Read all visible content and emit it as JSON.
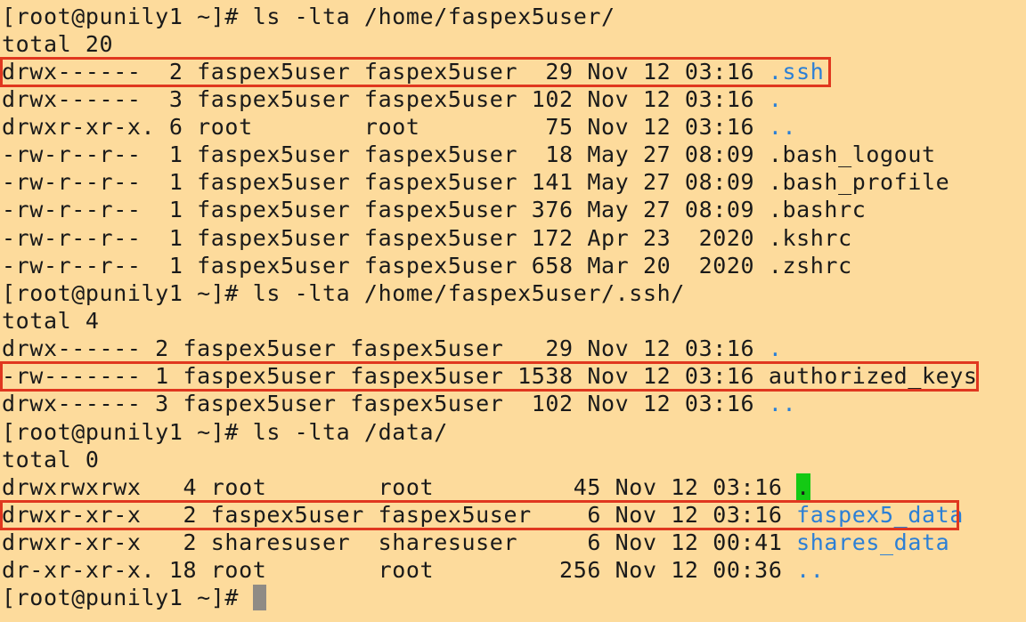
{
  "terminal": {
    "background": "#fddb9c",
    "link_color": "#2b7fd6",
    "highlight_color": "#e0371f",
    "cursor_color": "#8f8b85",
    "lines": [
      {
        "text": "[root@punily1 ~]# ls -lta /home/faspex5user/",
        "name": ""
      },
      {
        "text": "total 20",
        "name": ""
      },
      {
        "text": "drwx------  2 faspex5user faspex5user  29 Nov 12 03:16 ",
        "name": ".ssh"
      },
      {
        "text": "drwx------  3 faspex5user faspex5user 102 Nov 12 03:16 ",
        "name": "."
      },
      {
        "text": "drwxr-xr-x. 6 root        root         75 Nov 12 03:16 ",
        "name": ".."
      },
      {
        "text": "-rw-r--r--  1 faspex5user faspex5user  18 May 27 08:09 .bash_logout",
        "name": ""
      },
      {
        "text": "-rw-r--r--  1 faspex5user faspex5user 141 May 27 08:09 .bash_profile",
        "name": ""
      },
      {
        "text": "-rw-r--r--  1 faspex5user faspex5user 376 May 27 08:09 .bashrc",
        "name": ""
      },
      {
        "text": "-rw-r--r--  1 faspex5user faspex5user 172 Apr 23  2020 .kshrc",
        "name": ""
      },
      {
        "text": "-rw-r--r--  1 faspex5user faspex5user 658 Mar 20  2020 .zshrc",
        "name": ""
      },
      {
        "text": "[root@punily1 ~]# ls -lta /home/faspex5user/.ssh/",
        "name": ""
      },
      {
        "text": "total 4",
        "name": ""
      },
      {
        "text": "drwx------ 2 faspex5user faspex5user   29 Nov 12 03:16 ",
        "name": "."
      },
      {
        "text": "-rw------- 1 faspex5user faspex5user 1538 Nov 12 03:16 authorized_keys",
        "name": ""
      },
      {
        "text": "drwx------ 3 faspex5user faspex5user  102 Nov 12 03:16 ",
        "name": ".."
      },
      {
        "text": "[root@punily1 ~]# ls -lta /data/",
        "name": ""
      },
      {
        "text": "total 0",
        "name": ""
      },
      {
        "text": "drwxrwxrwx   4 root        root          45 Nov 12 03:16 ",
        "name": "."
      },
      {
        "text": "drwxr-xr-x   2 faspex5user faspex5user    6 Nov 12 03:16 ",
        "name": "faspex5_data"
      },
      {
        "text": "drwxr-xr-x   2 sharesuser  sharesuser     6 Nov 12 00:41 ",
        "name": "shares_data"
      },
      {
        "text": "dr-xr-xr-x. 18 root        root         256 Nov 12 00:36 ",
        "name": ".."
      },
      {
        "text": "[root@punily1 ~]# ",
        "name": ""
      }
    ]
  }
}
